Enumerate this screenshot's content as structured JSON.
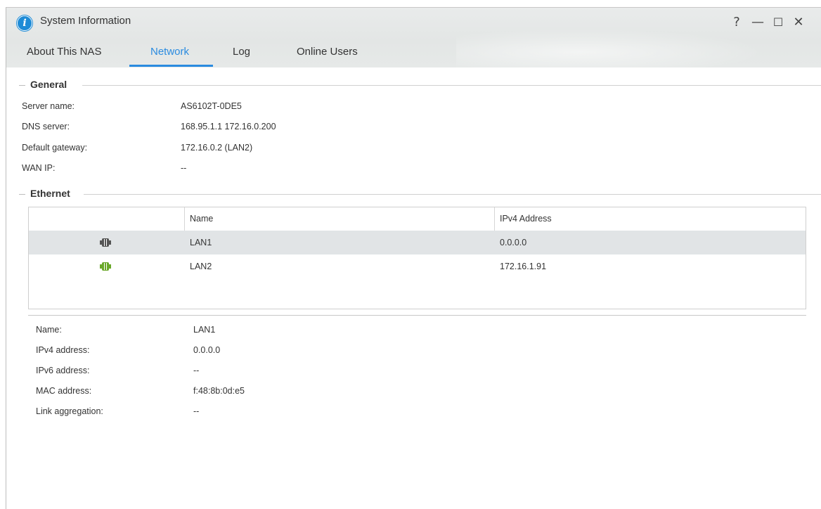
{
  "window": {
    "title": "System Information"
  },
  "window_controls": {
    "help": "?",
    "minimize": "—",
    "maximize": "☐",
    "close": "✕"
  },
  "tabs": [
    {
      "label": "About This NAS",
      "active": false
    },
    {
      "label": "Network",
      "active": true
    },
    {
      "label": "Log",
      "active": false
    },
    {
      "label": "Online Users",
      "active": false
    }
  ],
  "general": {
    "heading": "General",
    "rows": [
      {
        "label": "Server name:",
        "value": "AS6102T-0DE5"
      },
      {
        "label": "DNS server:",
        "value": "168.95.1.1 172.16.0.200"
      },
      {
        "label": "Default gateway:",
        "value": "172.16.0.2 (LAN2)"
      },
      {
        "label": "WAN IP:",
        "value": "--"
      }
    ]
  },
  "ethernet": {
    "heading": "Ethernet",
    "columns": [
      "",
      "Name",
      "IPv4 Address"
    ],
    "rows": [
      {
        "icon": "ethernet-port-disconnected-icon",
        "name": "LAN1",
        "ipv4": "0.0.0.0",
        "selected": true,
        "color": "#555555"
      },
      {
        "icon": "ethernet-port-connected-icon",
        "name": "LAN2",
        "ipv4": "172.16.1.91",
        "selected": false,
        "color": "#6aa82a"
      }
    ]
  },
  "details": {
    "rows": [
      {
        "label": "Name:",
        "value": "LAN1"
      },
      {
        "label": "IPv4 address:",
        "value": "0.0.0.0"
      },
      {
        "label": "IPv6 address:",
        "value": "--"
      },
      {
        "label": "MAC address:",
        "value": "f:48:8b:0d:e5"
      },
      {
        "label": "Link aggregation:",
        "value": "--"
      }
    ]
  },
  "colors": {
    "accent": "#2a8be0",
    "selected_row": "#e1e4e6",
    "connected": "#6aa82a",
    "disconnected": "#555555"
  }
}
